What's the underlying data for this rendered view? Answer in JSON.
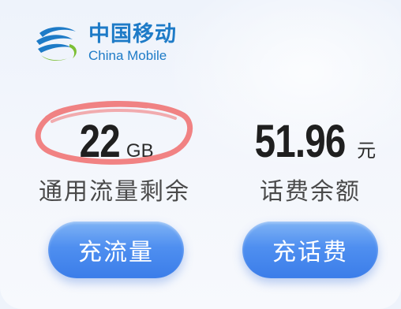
{
  "brand": {
    "name_cn": "中国移动",
    "name_en": "China Mobile",
    "logo_icon": "china-mobile-logo-icon",
    "color": "#1e7bc7"
  },
  "data_balance": {
    "value": "22",
    "unit": "GB",
    "label": "通用流量剩余"
  },
  "fee_balance": {
    "value": "51.96",
    "unit": "元",
    "label": "话费余额"
  },
  "buttons": {
    "recharge_data": "充流量",
    "recharge_fee": "充话费"
  },
  "colors": {
    "button_gradient_top": "#7fb3f5",
    "button_gradient_bottom": "#3b7de9",
    "annotation_red": "#f06d6d"
  }
}
